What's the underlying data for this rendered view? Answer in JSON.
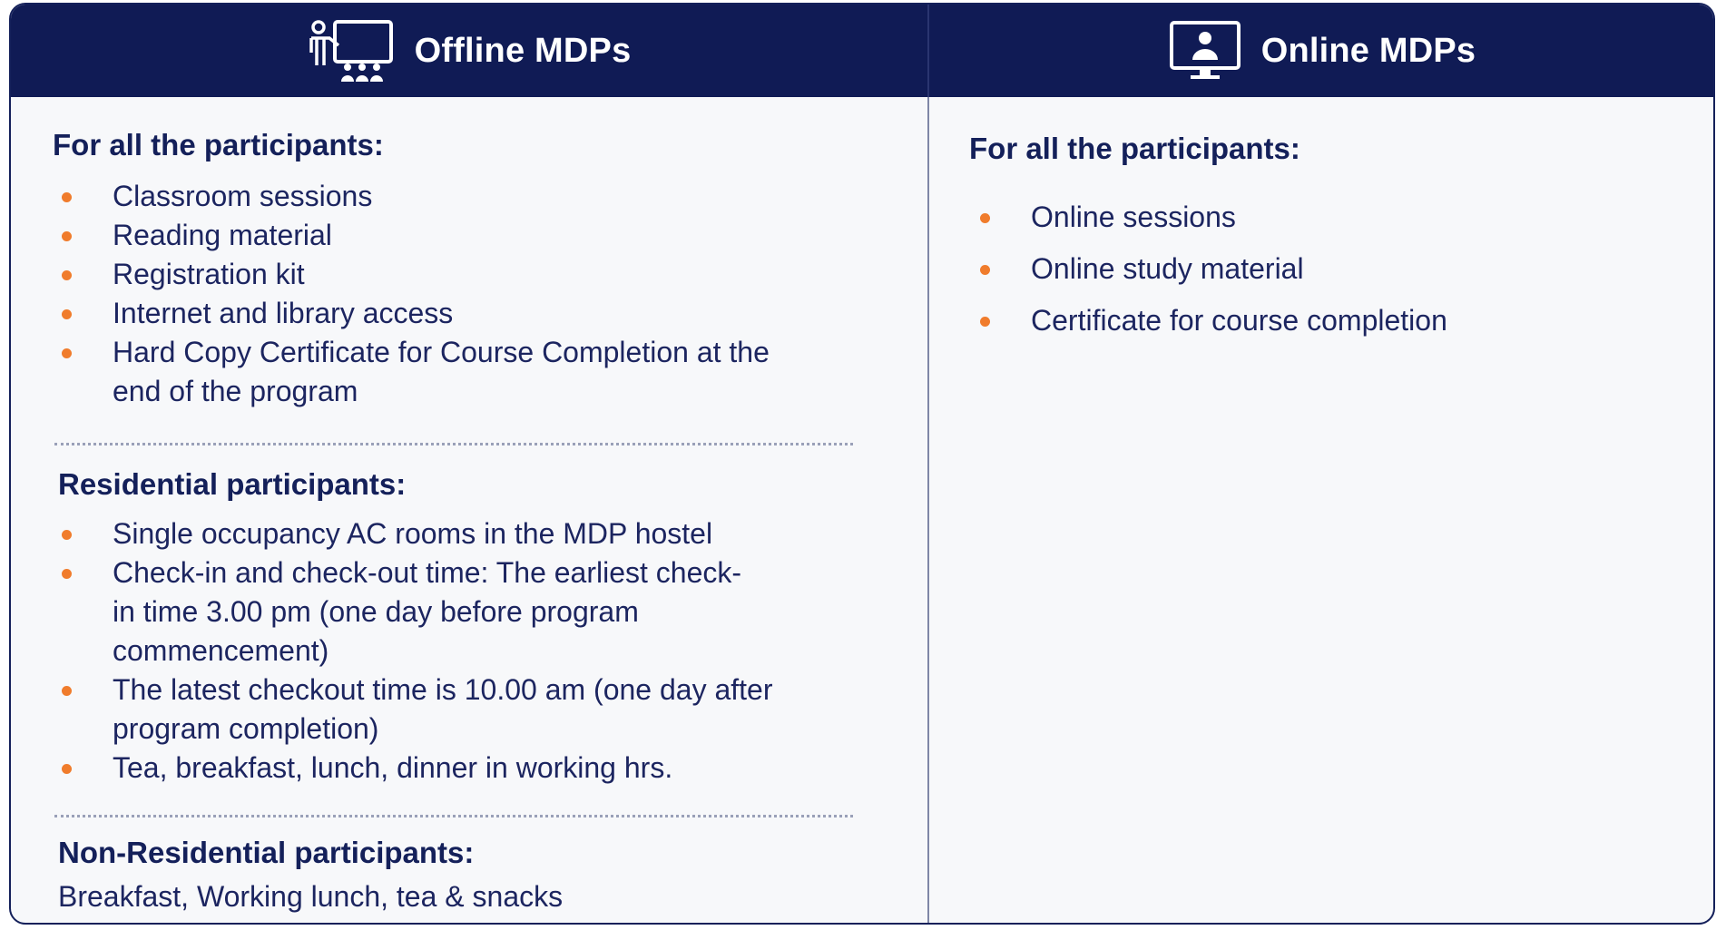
{
  "colors": {
    "header_bg": "#101b55",
    "title_text": "#14205a",
    "body_text": "#1c2560",
    "bullet": "#f07c2c",
    "panel_bg": "#f7f8fa"
  },
  "offline": {
    "header": "Offline MDPs",
    "icon": "classroom-presenter-icon",
    "all": {
      "title": "For all the participants:",
      "items": [
        "Classroom sessions",
        "Reading material",
        "Registration kit",
        "Internet and library access",
        "Hard Copy Certificate for Course Completion at the end of the program"
      ]
    },
    "residential": {
      "title": "Residential participants:",
      "items": [
        "Single occupancy AC rooms in the MDP hostel",
        "Check-in and check-out time: The earliest check-in time 3.00 pm (one day before program commencement)",
        "The latest checkout time is 10.00 am (one day after program completion)",
        "Tea, breakfast, lunch, dinner in working hrs."
      ]
    },
    "non_residential": {
      "title": "Non-Residential participants:",
      "text": "Breakfast, Working lunch, tea & snacks"
    }
  },
  "online": {
    "header": "Online MDPs",
    "icon": "monitor-user-icon",
    "all": {
      "title": "For all the participants:",
      "items": [
        "Online sessions",
        "Online study material",
        "Certificate for course completion"
      ]
    }
  }
}
